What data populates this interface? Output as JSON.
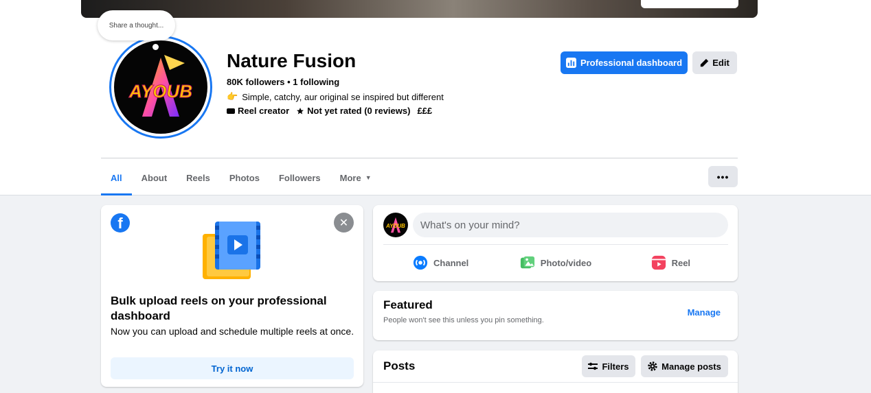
{
  "profile": {
    "thought_bubble": "Share a thought...",
    "page_name": "Nature Fusion",
    "followers_line": "80K followers • 1 following",
    "bio_emoji": "👉",
    "bio": "Simple, catchy, aur original se inspired but different",
    "category": "Reel creator",
    "rating": "Not yet rated (0 reviews)",
    "price": "£££",
    "logo_text": "AYOUB",
    "professional_dashboard_label": "Professional dashboard",
    "edit_label": "Edit"
  },
  "tabs": [
    {
      "label": "All"
    },
    {
      "label": "About"
    },
    {
      "label": "Reels"
    },
    {
      "label": "Photos"
    },
    {
      "label": "Followers"
    },
    {
      "label": "More"
    }
  ],
  "promo": {
    "title": "Bulk upload reels on your professional dashboard",
    "description": "Now you can upload and schedule multiple reels at once.",
    "button": "Try it now"
  },
  "composer": {
    "placeholder": "What's on your mind?",
    "actions": [
      {
        "label": "Channel",
        "icon": "channel-icon"
      },
      {
        "label": "Photo/video",
        "icon": "photo-video-icon"
      },
      {
        "label": "Reel",
        "icon": "reel-icon"
      }
    ]
  },
  "featured": {
    "title": "Featured",
    "subtitle": "People won't see this unless you pin something.",
    "manage": "Manage"
  },
  "posts": {
    "title": "Posts",
    "filters": "Filters",
    "manage_posts": "Manage posts"
  },
  "colors": {
    "accent": "#1877f2",
    "page_bg": "#f0f2f5",
    "text_secondary": "#65676b"
  }
}
